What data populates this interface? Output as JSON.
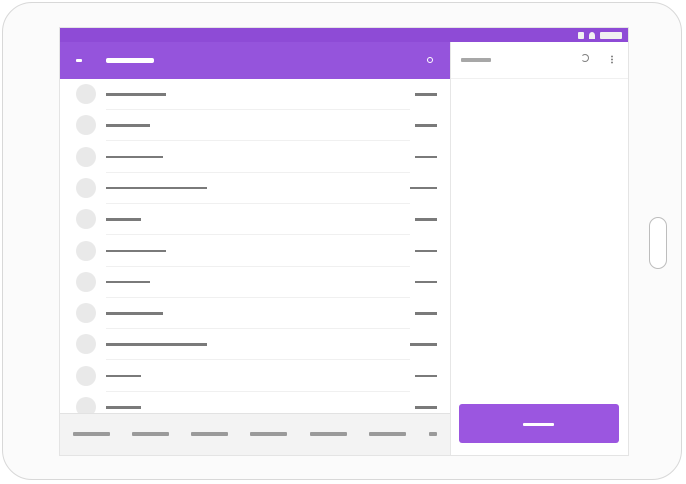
{
  "app": {
    "title": ""
  },
  "status_bar": {
    "icons": [
      "wifi-icon",
      "signal-icon",
      "battery-icon"
    ]
  },
  "toolbar": {
    "menu_icon": "menu-icon",
    "search_icon": "search-icon"
  },
  "list": {
    "items": [
      {
        "name": "",
        "time": "",
        "name_len": 60,
        "time_len": 22
      },
      {
        "name": "",
        "time": "",
        "name_len": 44,
        "time_len": 22
      },
      {
        "name": "",
        "time": "",
        "name_len": 57,
        "time_len": 22
      },
      {
        "name": "",
        "time": "",
        "name_len": 101,
        "time_len": 27
      },
      {
        "name": "",
        "time": "",
        "name_len": 35,
        "time_len": 22
      },
      {
        "name": "",
        "time": "",
        "name_len": 60,
        "time_len": 22
      },
      {
        "name": "",
        "time": "",
        "name_len": 44,
        "time_len": 22
      },
      {
        "name": "",
        "time": "",
        "name_len": 57,
        "time_len": 22
      },
      {
        "name": "",
        "time": "",
        "name_len": 101,
        "time_len": 27
      },
      {
        "name": "",
        "time": "",
        "name_len": 35,
        "time_len": 22
      },
      {
        "name": "",
        "time": "",
        "name_len": 35,
        "time_len": 22
      }
    ]
  },
  "bottom_tabs": [
    {
      "label": ""
    },
    {
      "label": ""
    },
    {
      "label": ""
    },
    {
      "label": ""
    },
    {
      "label": ""
    },
    {
      "label": ""
    },
    {
      "label": ""
    }
  ],
  "detail": {
    "title": "",
    "reply_icon": "reply-icon",
    "more_icon": "more-vert-icon",
    "primary_button_label": ""
  },
  "colors": {
    "accent": "#9554dc",
    "status_bar": "#8e4bd6",
    "button": "#9b56e0"
  }
}
